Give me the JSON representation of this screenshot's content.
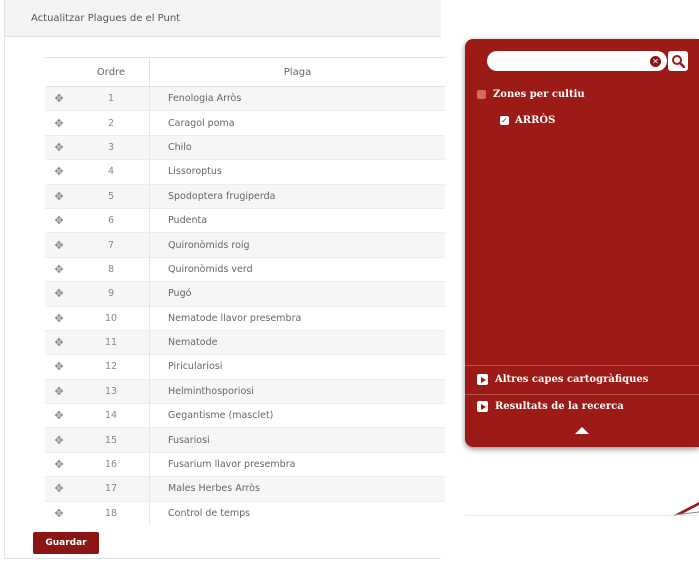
{
  "panel": {
    "title": "Actualitzar Plagues de el Punt",
    "columns": {
      "ordre": "Ordre",
      "plaga": "Plaga"
    },
    "rows": [
      {
        "ordre": "1",
        "plaga": "Fenologia Arròs"
      },
      {
        "ordre": "2",
        "plaga": "Caragol poma"
      },
      {
        "ordre": "3",
        "plaga": "Chilo"
      },
      {
        "ordre": "4",
        "plaga": "Lissoroptus"
      },
      {
        "ordre": "5",
        "plaga": "Spodoptera frugiperda"
      },
      {
        "ordre": "6",
        "plaga": "Pudenta"
      },
      {
        "ordre": "7",
        "plaga": "Quironòmids roig"
      },
      {
        "ordre": "8",
        "plaga": "Quironòmids verd"
      },
      {
        "ordre": "9",
        "plaga": "Pugó"
      },
      {
        "ordre": "10",
        "plaga": "Nematode llavor presembra"
      },
      {
        "ordre": "11",
        "plaga": "Nematode"
      },
      {
        "ordre": "12",
        "plaga": "Piriculariosi"
      },
      {
        "ordre": "13",
        "plaga": "Helminthosporiosi"
      },
      {
        "ordre": "14",
        "plaga": "Gegantisme (masclet)"
      },
      {
        "ordre": "15",
        "plaga": "Fusariosi"
      },
      {
        "ordre": "16",
        "plaga": "Fusarium llavor presembra"
      },
      {
        "ordre": "17",
        "plaga": "Males Herbes Arròs"
      },
      {
        "ordre": "18",
        "plaga": "Control de temps"
      }
    ],
    "save_label": "Guardar",
    "drag_icon": "move-handle-icon"
  },
  "map_sidebar": {
    "search_value": "",
    "zones_label": "Zones per cultiu",
    "zones_item": "ARRÒS",
    "zones_item_checked": true,
    "layers_label": "Altres capes cartogràfiques",
    "results_label": "Resultats de la recerca"
  },
  "colors": {
    "accent": "#9c1b16",
    "button": "#8b1414",
    "row_alt": "#f4f6f8"
  }
}
